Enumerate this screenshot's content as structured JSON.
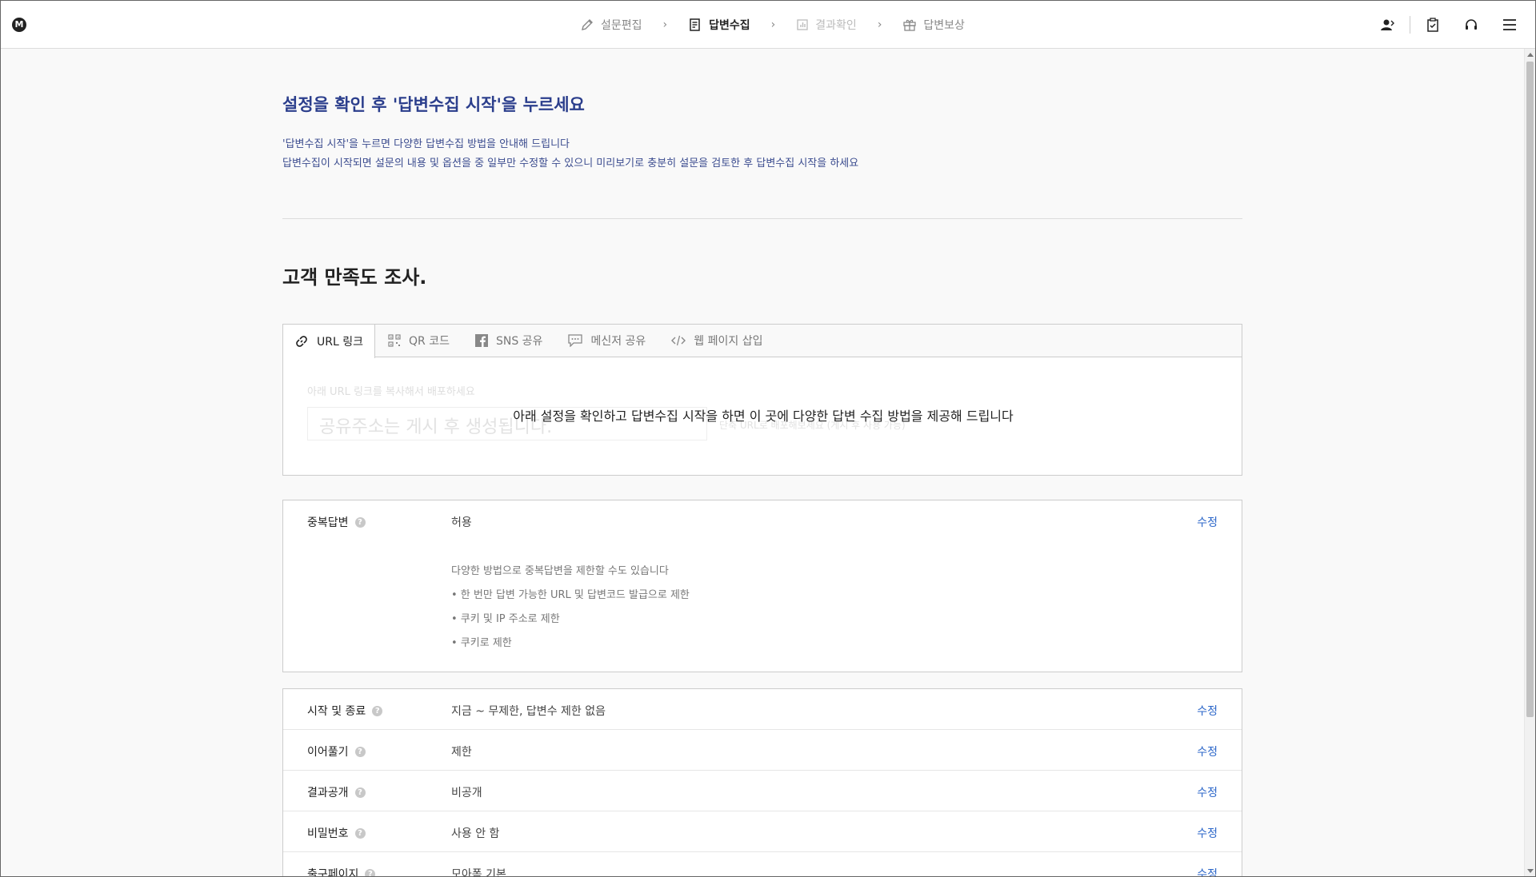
{
  "nav": {
    "logo": "M",
    "steps": [
      {
        "label": "설문편집",
        "icon": "pencil-icon",
        "state": "done"
      },
      {
        "label": "답변수집",
        "icon": "document-edit-icon",
        "state": "active"
      },
      {
        "label": "결과확인",
        "icon": "chart-icon",
        "state": "disabled"
      },
      {
        "label": "답변보상",
        "icon": "gift-icon",
        "state": "normal"
      }
    ],
    "right_icons": [
      "user-icon",
      "clipboard-check-icon",
      "headset-icon",
      "menu-icon"
    ]
  },
  "intro": {
    "headline": "설정을 확인 후 '답변수집 시작'을 누르세요",
    "line1": "'답변수집 시작'을 누르면 다양한 답변수집 방법을 안내해 드립니다",
    "line2": "답변수집이 시작되면 설문의 내용 및 옵션을 중 일부만 수정할 수 있으니 미리보기로 충분히 설문을 검토한 후 답변수집 시작을 하세요"
  },
  "survey": {
    "title": "고객 만족도 조사."
  },
  "share": {
    "tabs": [
      {
        "label": "URL 링크",
        "icon": "link-icon",
        "active": true
      },
      {
        "label": "QR 코드",
        "icon": "qr-code-icon",
        "active": false
      },
      {
        "label": "SNS 공유",
        "icon": "facebook-icon",
        "active": false
      },
      {
        "label": "메신저 공유",
        "icon": "chat-icon",
        "active": false
      },
      {
        "label": "웹 페이지 삽입",
        "icon": "code-icon",
        "active": false
      }
    ],
    "hint": "아래 URL 링크를 복사해서 배포하세요",
    "placeholder": "공유주소는 게시 후 생성됩니다.",
    "side_text": "단축 URL로 배포해보세요 (게시 후 사용 가능)",
    "overlay": "아래 설정을 확인하고 답변수집 시작을 하면 이 곳에 다양한 답변 수집 방법을 제공해 드립니다"
  },
  "duplicate": {
    "label": "중복답변",
    "value": "허용",
    "edit": "수정",
    "notes": [
      "다양한 방법으로 중복답변을 제한할 수도 있습니다",
      "• 한 번만 답변 가능한 URL 및 답변코드 발급으로 제한",
      "• 쿠키 및 IP 주소로 제한",
      "• 쿠키로 제한"
    ]
  },
  "settings": [
    {
      "label": "시작 및 종료",
      "value": "지금 ~ 무제한, 답변수 제한 없음",
      "edit": "수정"
    },
    {
      "label": "이어풀기",
      "value": "제한",
      "edit": "수정"
    },
    {
      "label": "결과공개",
      "value": "비공개",
      "edit": "수정"
    },
    {
      "label": "비밀번호",
      "value": "사용 안 함",
      "edit": "수정"
    },
    {
      "label": "출구페이지",
      "value": "모아폼 기본",
      "edit": "수정"
    }
  ]
}
